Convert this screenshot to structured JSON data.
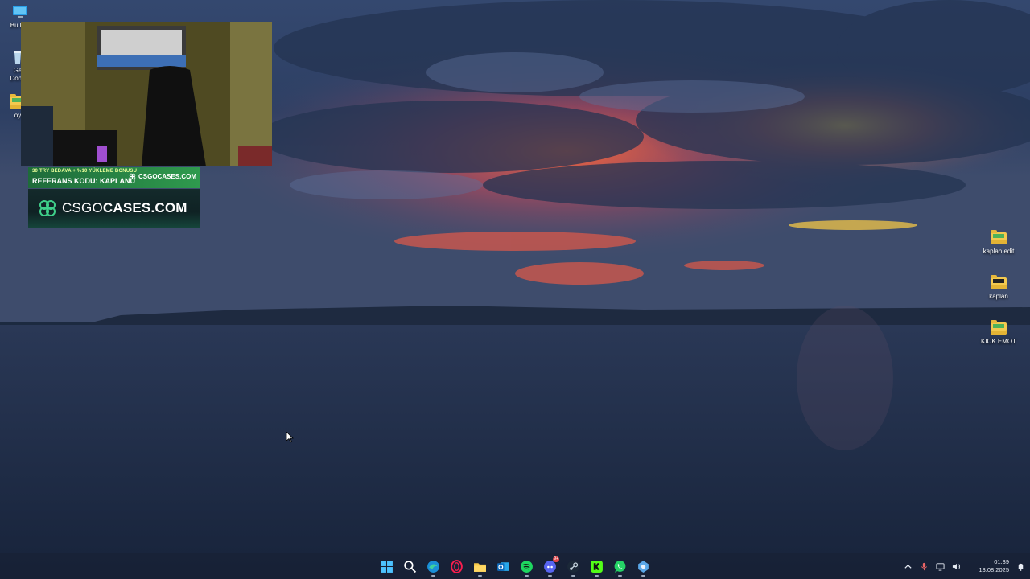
{
  "desktop": {
    "icons_left": [
      {
        "label": "Bu bilg",
        "icon": "this-pc-icon"
      },
      {
        "label": "Ge\nDönü",
        "icon": "recycle-bin-icon"
      },
      {
        "label": "oy",
        "icon": "folder-icon"
      }
    ],
    "icons_right": [
      {
        "label": "kaplan edit",
        "icon": "folder-icon"
      },
      {
        "label": "kaplan",
        "icon": "folder-icon"
      },
      {
        "label": "KICK EMOT",
        "icon": "folder-icon"
      }
    ]
  },
  "promo": {
    "line1": "30 TRY BEDAVA + %10 YÜKLEME BONUSU",
    "line2": "REFERANS KODU: KAPLANU",
    "brand_small": "CSGOCASES.COM",
    "brand_main_light": "CSGO",
    "brand_main_bold": "CASES.COM"
  },
  "taskbar": {
    "apps": [
      {
        "name": "start",
        "icon": "windows-start-icon"
      },
      {
        "name": "search",
        "icon": "search-icon"
      },
      {
        "name": "edge",
        "icon": "edge-icon"
      },
      {
        "name": "opera-gx",
        "icon": "opera-gx-icon"
      },
      {
        "name": "file-explorer",
        "icon": "file-explorer-icon"
      },
      {
        "name": "outlook",
        "icon": "outlook-icon"
      },
      {
        "name": "spotify",
        "icon": "spotify-icon"
      },
      {
        "name": "discord",
        "icon": "discord-icon",
        "badge": "9+"
      },
      {
        "name": "steam",
        "icon": "steam-icon"
      },
      {
        "name": "kick",
        "icon": "kick-icon"
      },
      {
        "name": "whatsapp",
        "icon": "whatsapp-icon"
      },
      {
        "name": "app-extra",
        "icon": "gear-app-icon"
      }
    ],
    "clock": {
      "time": "01:39",
      "date": "13.08.2025"
    }
  },
  "colors": {
    "sky_top": "#3b4f77",
    "sea": "#1f2d47",
    "sunset": "#e2553a",
    "promo_green": "#2f9a4e"
  }
}
